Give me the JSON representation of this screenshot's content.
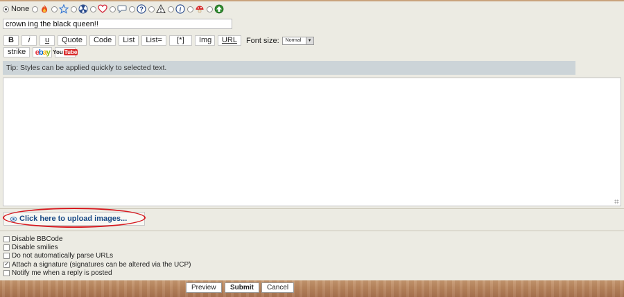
{
  "icons": {
    "none_label": "None",
    "items": [
      "fire-icon",
      "star-icon",
      "radioactive-icon",
      "heart-icon",
      "speech-bubble-icon",
      "question-icon",
      "warning-icon",
      "info-icon",
      "red-mushroom-icon",
      "green-arrow-up-icon"
    ]
  },
  "subject": {
    "value": "crown ing the black queen!!"
  },
  "toolbar": {
    "bold_label": "B",
    "italic_label": "i",
    "underline_label": "u",
    "quote_label": "Quote",
    "code_label": "Code",
    "list_label": "List",
    "list_eq_label": "List=",
    "list_item_label": "[*]",
    "img_label": "Img",
    "url_label": "URL",
    "font_size_label": "Font size:",
    "font_size_value": "Normal",
    "strike_label": "strike",
    "ebay_label": "ebay",
    "youtube_you": "You",
    "youtube_tube": "Tube"
  },
  "tip": "Tip: Styles can be applied quickly to selected text.",
  "message": {
    "value": ""
  },
  "upload": {
    "label": "Click here to upload images..."
  },
  "options": [
    {
      "label": "Disable BBCode",
      "checked": false
    },
    {
      "label": "Disable smilies",
      "checked": false
    },
    {
      "label": "Do not automatically parse URLs",
      "checked": false
    },
    {
      "label": "Attach a signature (signatures can be altered via the UCP)",
      "checked": true
    },
    {
      "label": "Notify me when a reply is posted",
      "checked": false
    }
  ],
  "buttons": {
    "preview": "Preview",
    "submit": "Submit",
    "cancel": "Cancel"
  },
  "colors": {
    "tip_bg": "#ccd4d8",
    "upload_link": "#1a4a86",
    "highlight_oval": "#d6191f",
    "panel_bg": "#ecebe3"
  }
}
